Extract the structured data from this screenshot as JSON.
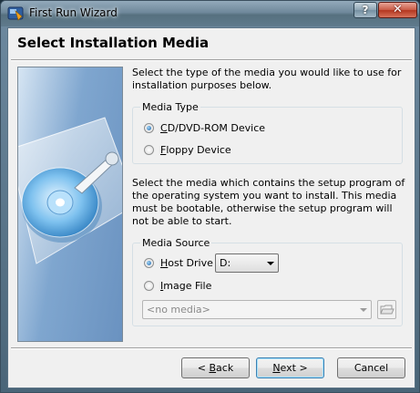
{
  "window": {
    "title": "First Run Wizard",
    "app_icon": "virtualbox-icon",
    "help_icon": "help-icon",
    "close_icon": "close-icon"
  },
  "page": {
    "title": "Select Installation Media",
    "banner_icon": "hard-disk-wizard-icon"
  },
  "intro_text": "Select the type of the media you would like to use for installation purposes below.",
  "media_type": {
    "label": "Media Type",
    "options": [
      {
        "label": "CD/DVD-ROM Device",
        "mnemonic": "C",
        "rest": "D/DVD-ROM Device",
        "selected": true
      },
      {
        "label": "Floppy Device",
        "mnemonic": "F",
        "rest": "loppy Device",
        "selected": false
      }
    ]
  },
  "source_text": "Select the media which contains the setup program of the operating system you want to install. This media must be bootable, otherwise the setup program will not be able to start.",
  "media_source": {
    "label": "Media Source",
    "host_drive": {
      "label": "Host Drive",
      "mnemonic": "H",
      "rest": "ost Drive",
      "selected": true,
      "value": "D:"
    },
    "image_file": {
      "label": "Image File",
      "mnemonic": "I",
      "rest": "mage File",
      "selected": false
    },
    "image_combo_value": "<no media>",
    "image_browse_icon": "open-folder-icon"
  },
  "buttons": {
    "back": {
      "label": "< Back",
      "pre": "< ",
      "mnemonic": "B",
      "rest": "ack"
    },
    "next": {
      "label": "Next >",
      "pre": "",
      "mnemonic": "N",
      "rest": "ext >"
    },
    "cancel": {
      "label": "Cancel"
    }
  },
  "colors": {
    "accent": "#3c7fb1",
    "close": "#c95a45",
    "banner": "#6a92c0"
  }
}
